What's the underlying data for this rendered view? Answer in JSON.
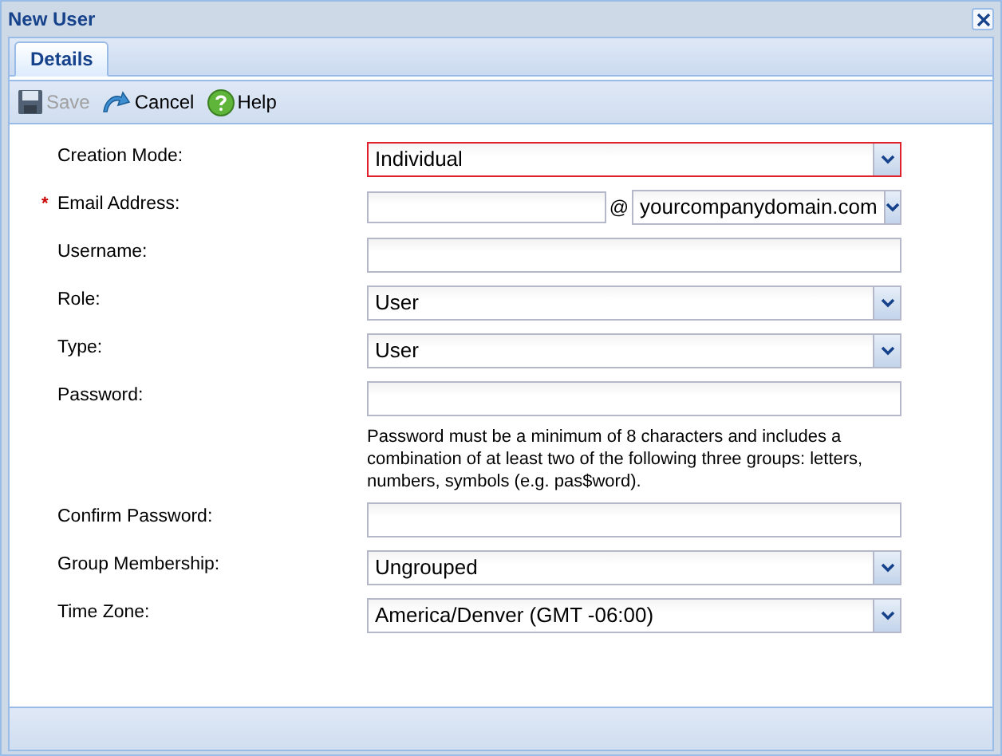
{
  "window": {
    "title": "New User"
  },
  "tabs": [
    {
      "label": "Details",
      "selected": true
    }
  ],
  "toolbar": [
    {
      "kind": "save",
      "label": "Save",
      "disabled": true
    },
    {
      "kind": "cancel",
      "label": "Cancel",
      "disabled": false
    },
    {
      "kind": "help",
      "label": "Help",
      "disabled": false
    }
  ],
  "fields": [
    {
      "kind": "select",
      "label": "Creation Mode:",
      "value": "Individual",
      "invalid": true
    },
    {
      "kind": "email",
      "label": "Email Address:",
      "required_mark": "*",
      "at": "@",
      "domain": "yourcompanydomain.com",
      "invalid": false
    },
    {
      "kind": "text",
      "label": "Username:",
      "invalid": false
    },
    {
      "kind": "select",
      "label": "Role:",
      "value": "User",
      "invalid": false
    },
    {
      "kind": "select",
      "label": "Type:",
      "value": "User",
      "invalid": false
    },
    {
      "kind": "password",
      "label": "Password:",
      "invalid": false,
      "hint": "Password must be a minimum of 8 characters and includes a combination of at least two of the following three groups: letters, numbers, symbols (e.g. pas$word)."
    },
    {
      "kind": "password",
      "label": "Confirm Password:",
      "invalid": false
    },
    {
      "kind": "select",
      "label": "Group Membership:",
      "value": "Ungrouped",
      "invalid": false
    },
    {
      "kind": "select",
      "label": "Time Zone:",
      "value": "America/Denver (GMT -06:00)",
      "invalid": false
    }
  ]
}
